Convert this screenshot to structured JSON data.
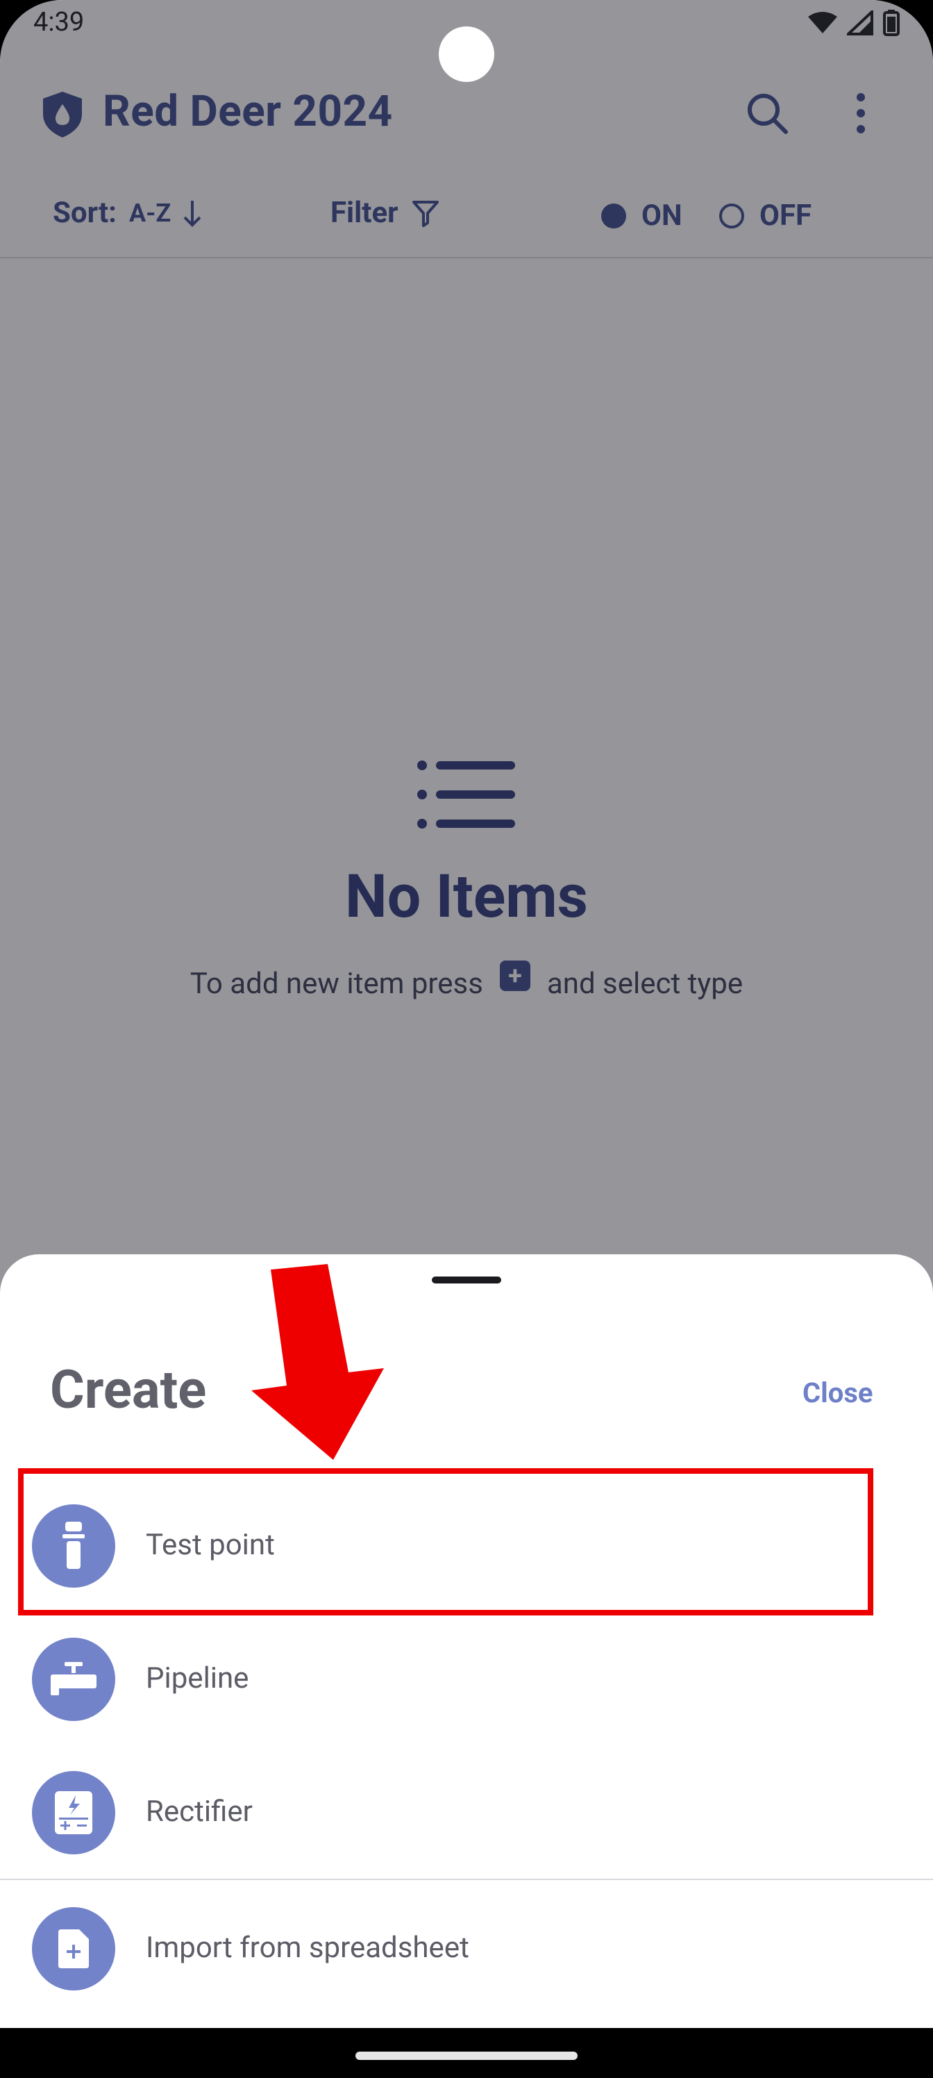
{
  "status_bar": {
    "time": "4:39"
  },
  "app_bar": {
    "title": "Red Deer 2024"
  },
  "toolbar": {
    "sort_label": "Sort:",
    "sort_value": "A-Z",
    "filter_label": "Filter",
    "on_label": "ON",
    "off_label": "OFF",
    "selected": "ON"
  },
  "empty_state": {
    "title": "No Items",
    "subtitle_before": "To add new item press",
    "subtitle_after": "and select type"
  },
  "sheet": {
    "title": "Create",
    "close_label": "Close",
    "items": [
      {
        "label": "Test point",
        "icon": "test-point-icon"
      },
      {
        "label": "Pipeline",
        "icon": "pipeline-icon"
      },
      {
        "label": "Rectifier",
        "icon": "rectifier-icon"
      },
      {
        "label": "Import from spreadsheet",
        "icon": "file-add-icon"
      }
    ]
  },
  "colors": {
    "primary": "#3f4d8f",
    "icon_circle": "#7383c9",
    "close_link": "#6d80c8",
    "annotation": "#ee0000"
  }
}
